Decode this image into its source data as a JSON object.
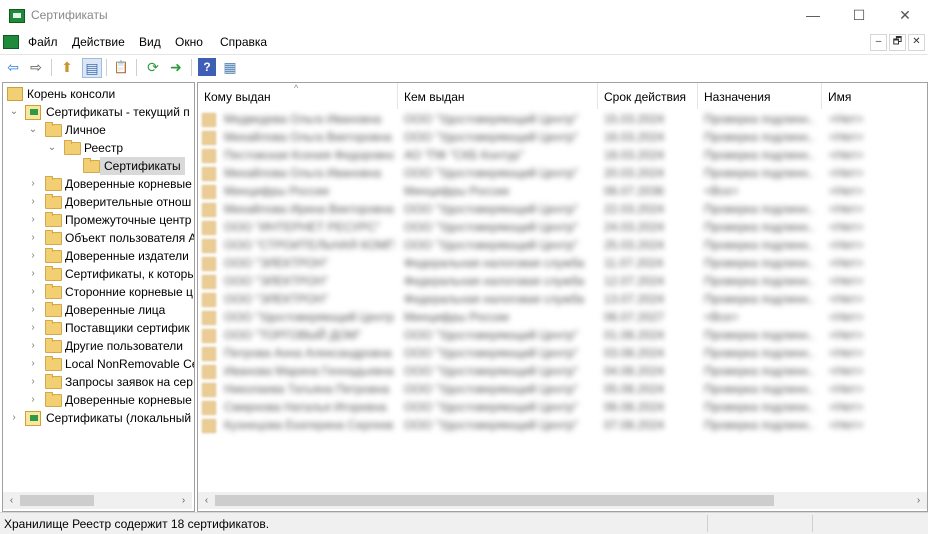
{
  "window": {
    "title": "Сертификаты",
    "min_glyph": "—",
    "max_glyph": "☐",
    "close_glyph": "✕"
  },
  "menu": {
    "items": [
      "Файл",
      "Действие",
      "Вид",
      "Окно",
      "Справка"
    ]
  },
  "mdi": {
    "min_glyph": "–",
    "restore_glyph": "🗗",
    "close_glyph": "✕"
  },
  "toolbar": {
    "back": "⇦",
    "forward": "⇨",
    "up": "⬆",
    "tree_toggle": "▤",
    "properties": "📋",
    "refresh": "⟳",
    "export": "➜",
    "help": "?",
    "mmc_view": "▦"
  },
  "tree": {
    "root": "Корень консоли",
    "current_user": "Сертификаты - текущий п",
    "personal": "Личное",
    "registry": "Реестр",
    "certificates": "Сертификаты",
    "stores": [
      "Доверенные корневые",
      "Доверительные отнош",
      "Промежуточные центр",
      "Объект пользователя А",
      "Доверенные издатели",
      "Сертификаты, к которь",
      "Сторонние корневые ц",
      "Доверенные лица",
      "Поставщики сертифик",
      "Другие пользователи",
      "Local NonRemovable Ce",
      "Запросы заявок на сер",
      "Доверенные корневые"
    ],
    "local": "Сертификаты (локальный"
  },
  "list": {
    "columns": [
      "Кому выдан",
      "Кем выдан",
      "Срок действия",
      "Назначения",
      "Имя"
    ],
    "sort_glyph": "^",
    "rows": [
      [
        "Медведева Ольга Ивановна",
        "ООО \"Удостоверяющий Центр\"",
        "15.03.2024",
        "Проверка подлинн...",
        "<Нет>"
      ],
      [
        "Михайлова Ольга Викторовна",
        "ООО \"Удостоверяющий Центр\"",
        "16.03.2024",
        "Проверка подлинн...",
        "<Нет>"
      ],
      [
        "Пестовская Ксения Федоровна",
        "АО \"ПФ \"СКБ Контур\"",
        "18.03.2024",
        "Проверка подлинн...",
        "<Нет>"
      ],
      [
        "Михайлова Ольга Ивановна",
        "ООО \"Удостоверяющий Центр\"",
        "20.03.2024",
        "Проверка подлинн...",
        "<Нет>"
      ],
      [
        "Минцифры России",
        "Минцифры России",
        "06.07.2036",
        "<Все>",
        "<Нет>"
      ],
      [
        "Михайлова Ирина Викторовна",
        "ООО \"Удостоверяющий Центр\"",
        "22.03.2024",
        "Проверка подлинн...",
        "<Нет>"
      ],
      [
        "ООО \"ИНТЕРНЕТ РЕСУРС\"",
        "ООО \"Удостоверяющий Центр\"",
        "24.03.2024",
        "Проверка подлинн...",
        "<Нет>"
      ],
      [
        "ООО \"СТРОИТЕЛЬНАЯ КОМПАНИЯ\"",
        "ООО \"Удостоверяющий Центр\"",
        "25.03.2024",
        "Проверка подлинн...",
        "<Нет>"
      ],
      [
        "ООО \"ЭЛЕКТРОН\"",
        "Федеральная налоговая служба",
        "11.07.2024",
        "Проверка подлинн...",
        "<Нет>"
      ],
      [
        "ООО \"ЭЛЕКТРОН\"",
        "Федеральная налоговая служба",
        "12.07.2024",
        "Проверка подлинн...",
        "<Нет>"
      ],
      [
        "ООО \"ЭЛЕКТРОН\"",
        "Федеральная налоговая служба",
        "13.07.2024",
        "Проверка подлинн...",
        "<Нет>"
      ],
      [
        "ООО \"Удостоверяющий Центр\"",
        "Минцифры России",
        "06.07.2027",
        "<Все>",
        "<Нет>"
      ],
      [
        "ООО \"ТОРГОВЫЙ ДОМ\"",
        "ООО \"Удостоверяющий Центр\"",
        "01.08.2024",
        "Проверка подлинн...",
        "<Нет>"
      ],
      [
        "Петрова Анна Александровна",
        "ООО \"Удостоверяющий Центр\"",
        "03.08.2024",
        "Проверка подлинн...",
        "<Нет>"
      ],
      [
        "Иванова Марина Геннадьевна",
        "ООО \"Удостоверяющий Центр\"",
        "04.08.2024",
        "Проверка подлинн...",
        "<Нет>"
      ],
      [
        "Николаева Татьяна Петровна",
        "ООО \"Удостоверяющий Центр\"",
        "05.08.2024",
        "Проверка подлинн...",
        "<Нет>"
      ],
      [
        "Смирнова Наталья Игоревна",
        "ООО \"Удостоверяющий Центр\"",
        "06.08.2024",
        "Проверка подлинн...",
        "<Нет>"
      ],
      [
        "Кузнецова Екатерина Сергеевна",
        "ООО \"Удостоверяющий Центр\"",
        "07.08.2024",
        "Проверка подлинн...",
        "<Нет>"
      ]
    ]
  },
  "scroll": {
    "left": "‹",
    "right": "›"
  },
  "status": {
    "text": "Хранилище Реестр содержит 18 сертификатов."
  }
}
